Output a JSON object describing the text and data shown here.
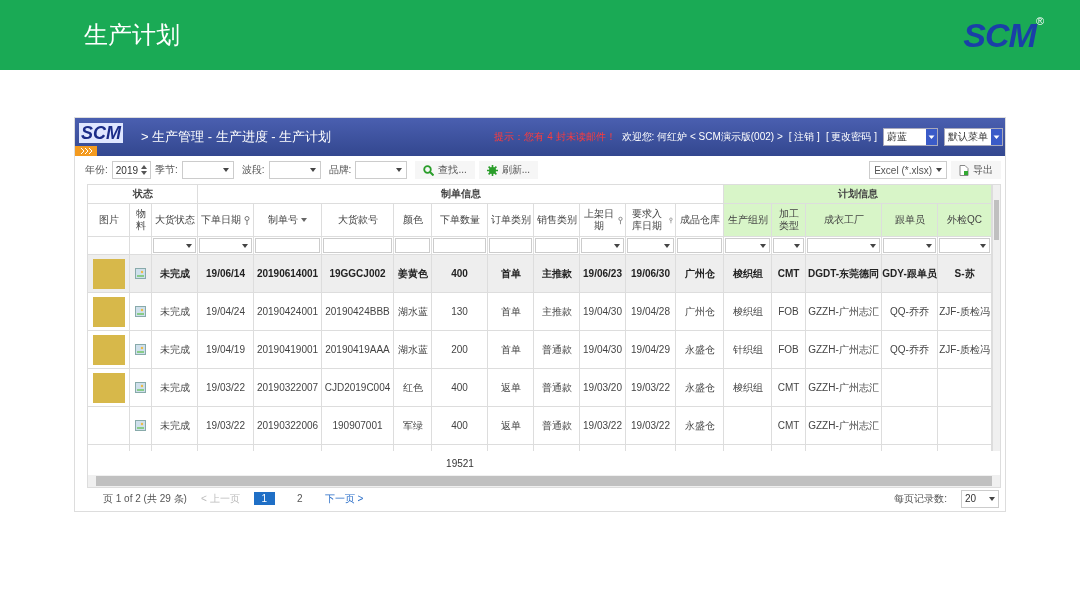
{
  "slide": {
    "title": "生产计划",
    "logo": "SCM",
    "logo_mark": "®"
  },
  "app": {
    "logo": "SCM",
    "breadcrumb": "> 生产管理 - 生产进度 - 生产计划",
    "notice": "提示：您有 4 封未读邮件！",
    "welcome": "欢迎您: 何红妒 < SCM演示版(002) >",
    "links": [
      "[ 注销 ]",
      "[ 更改密码 ]"
    ],
    "theme_select": "蔚蓝",
    "menu_select": "默认菜单"
  },
  "toolbar": {
    "year_label": "年份:",
    "year": "2019",
    "filters": [
      {
        "label": "季节:"
      },
      {
        "label": "波段:"
      },
      {
        "label": "品牌:"
      }
    ],
    "buttons": [
      {
        "kind": "search",
        "label": "查找..."
      },
      {
        "kind": "refresh",
        "label": "刷新..."
      }
    ],
    "export_format": "Excel (*.xlsx)",
    "export_button": "导出"
  },
  "table": {
    "groups": [
      {
        "label": "状态",
        "tinted": false
      },
      {
        "label": "制单信息",
        "tinted": false
      },
      {
        "label": "计划信息",
        "tinted": true
      }
    ],
    "columns": [
      {
        "label": "图片",
        "kind": "none"
      },
      {
        "label": "物料",
        "kind": "none"
      },
      {
        "label": "大货状态",
        "kind": "dropdown"
      },
      {
        "label": "下单日期",
        "kind": "dropdown",
        "filterable": true
      },
      {
        "label": "制单号",
        "kind": "text",
        "sorted": true
      },
      {
        "label": "大货款号",
        "kind": "text"
      },
      {
        "label": "颜色",
        "kind": "text"
      },
      {
        "label": "下单数量",
        "kind": "text",
        "total": "19521"
      },
      {
        "label": "订单类别",
        "kind": "text"
      },
      {
        "label": "销售类别",
        "kind": "text"
      },
      {
        "label": "上架日期",
        "kind": "dropdown",
        "filterable": true
      },
      {
        "label": "要求入库日期",
        "kind": "dropdown",
        "filterable": true
      },
      {
        "label": "成品仓库",
        "kind": "text"
      },
      {
        "label": "生产组别",
        "kind": "dropdown"
      },
      {
        "label": "加工类型",
        "kind": "dropdown"
      },
      {
        "label": "成衣工厂",
        "kind": "dropdown"
      },
      {
        "label": "跟单员",
        "kind": "dropdown"
      },
      {
        "label": "外检QC",
        "kind": "dropdown"
      }
    ],
    "rows": [
      {
        "selected": true,
        "has_image": true,
        "cells": [
          "",
          "",
          "未完成",
          "19/06/14",
          "20190614001",
          "19GGCJ002",
          "姜黄色",
          "400",
          "首单",
          "主推款",
          "19/06/23",
          "19/06/30",
          "广州仓",
          "梭织组",
          "CMT",
          "DGDT-东莞德同",
          "GDY-跟单员",
          "S-苏"
        ]
      },
      {
        "selected": false,
        "has_image": true,
        "cells": [
          "",
          "",
          "未完成",
          "19/04/24",
          "20190424001",
          "20190424BBB",
          "湖水蓝",
          "130",
          "首单",
          "主推款",
          "19/04/30",
          "19/04/28",
          "广州仓",
          "梭织组",
          "FOB",
          "GZZH-广州志汇",
          "QQ-乔乔",
          "ZJF-质检冯"
        ]
      },
      {
        "selected": false,
        "has_image": true,
        "cells": [
          "",
          "",
          "未完成",
          "19/04/19",
          "20190419001",
          "20190419AAA",
          "湖水蓝",
          "200",
          "首单",
          "普通款",
          "19/04/30",
          "19/04/29",
          "永盛仓",
          "针织组",
          "FOB",
          "GZZH-广州志汇",
          "QQ-乔乔",
          "ZJF-质检冯"
        ]
      },
      {
        "selected": false,
        "has_image": true,
        "cells": [
          "",
          "",
          "未完成",
          "19/03/22",
          "20190322007",
          "CJD2019C004",
          "红色",
          "400",
          "返单",
          "普通款",
          "19/03/20",
          "19/03/22",
          "永盛仓",
          "梭织组",
          "CMT",
          "GZZH-广州志汇",
          "",
          ""
        ]
      },
      {
        "selected": false,
        "has_image": false,
        "cells": [
          "",
          "",
          "未完成",
          "19/03/22",
          "20190322006",
          "190907001",
          "军绿",
          "400",
          "返单",
          "普通款",
          "19/03/22",
          "19/03/22",
          "永盛仓",
          "",
          "CMT",
          "GZZH-广州志汇",
          "",
          ""
        ]
      }
    ]
  },
  "pager": {
    "summary": "页 1 of 2 (共 29 条)",
    "prev": {
      "label": "< 上一页",
      "disabled": true
    },
    "pages": [
      {
        "label": "1",
        "selected": true
      },
      {
        "label": "2",
        "selected": false
      }
    ],
    "next": {
      "label": "下一页 >",
      "disabled": false
    },
    "page_size_label": "每页记录数:",
    "page_size": "20"
  }
}
